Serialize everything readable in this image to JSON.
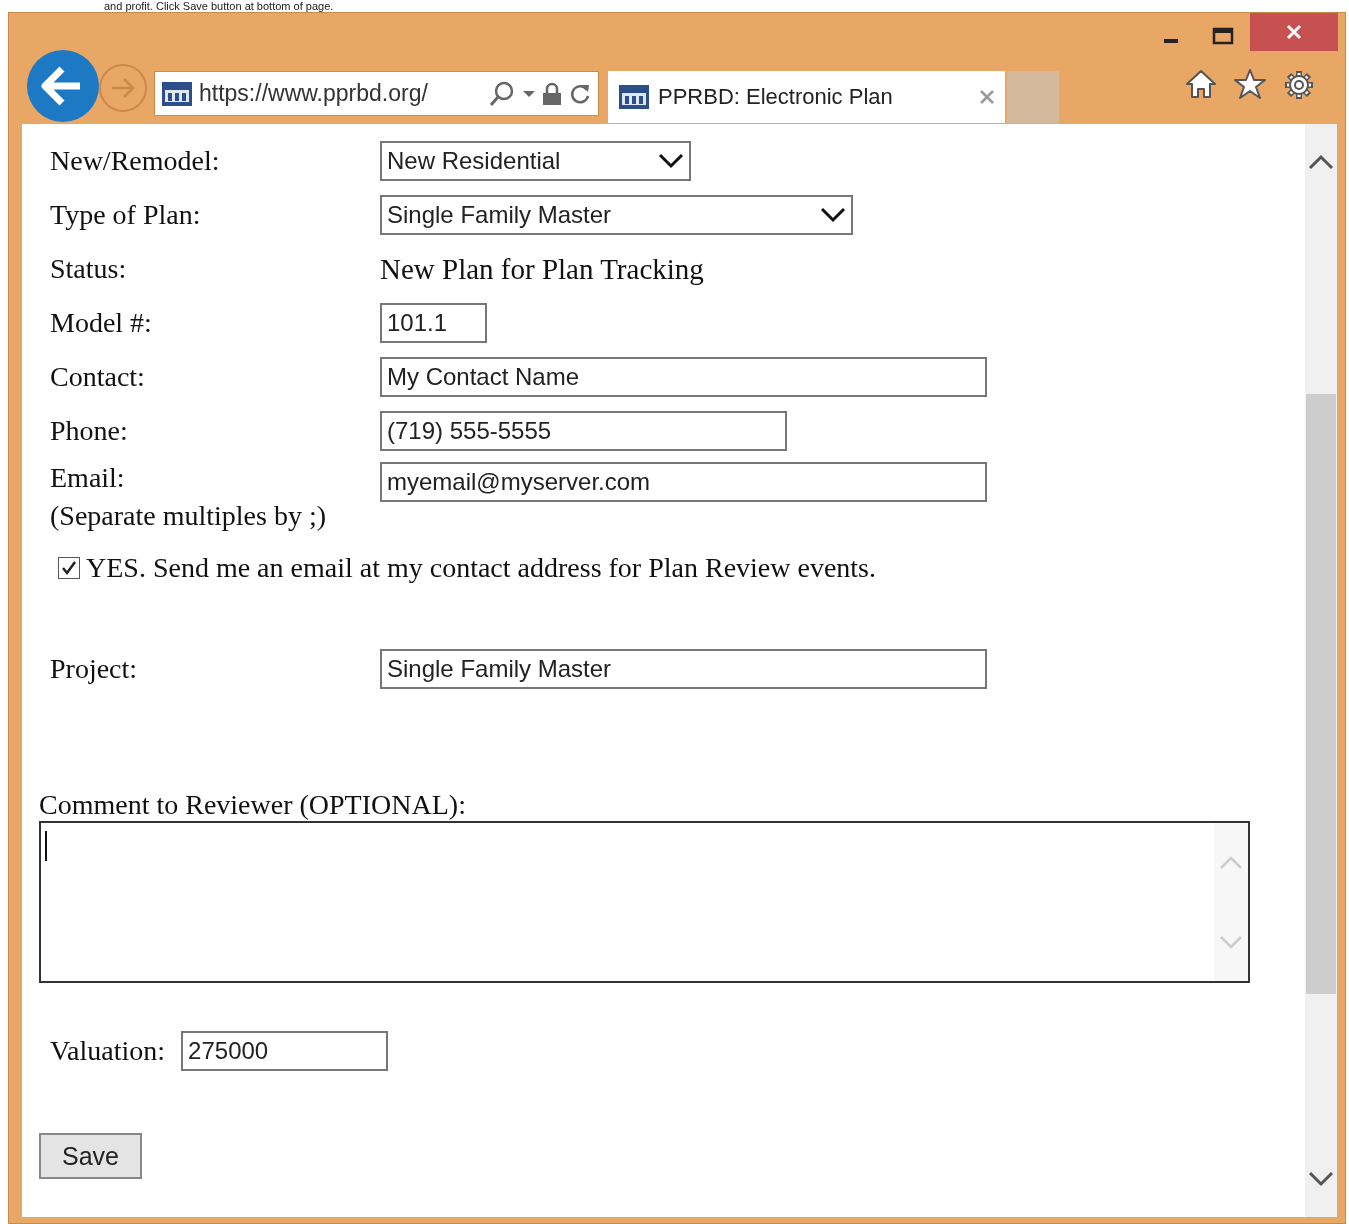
{
  "instruction": "and profit.  Click Save button at bottom of page.",
  "browser": {
    "address": "https://www.pprbd.org/",
    "tabs": [
      {
        "title": "PPRBD: Electronic Plan",
        "selected": true
      }
    ]
  },
  "form": {
    "fields": [
      {
        "label": "New/Remodel:",
        "kind": "select",
        "value": "New Residential"
      },
      {
        "label": "Type of Plan:",
        "kind": "select",
        "value": "Single Family Master"
      },
      {
        "label": "Status:",
        "kind": "text",
        "value": "New Plan for Plan Tracking"
      },
      {
        "label": "Model #:",
        "kind": "input",
        "value": "101.1"
      },
      {
        "label": "Contact:",
        "kind": "input",
        "value": "My Contact Name"
      },
      {
        "label": "Phone:",
        "kind": "input",
        "value": "(719) 555-5555"
      },
      {
        "label": "Email:",
        "kind": "input",
        "value": "myemail@myserver.com",
        "note": "(Separate multiples by ;)"
      }
    ],
    "notify": {
      "label": "YES. Send me an email at my contact address for Plan Review events.",
      "checked": true
    },
    "project": {
      "label": "Project:",
      "value": "Single Family Master"
    },
    "comment": {
      "label": "Comment to Reviewer (OPTIONAL):"
    },
    "valuation": {
      "label": "Valuation:",
      "value": "275000"
    },
    "save": "Save"
  }
}
